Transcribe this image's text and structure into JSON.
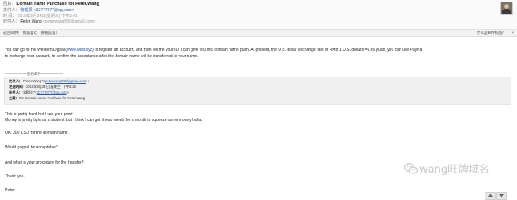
{
  "header": {
    "subject_key": "回复：",
    "subject": "Domain name Purchase for Peter.Wang",
    "from_key": "发件人：",
    "from_name": "管理员",
    "from_email": "<32777077@qq.com>",
    "time_key": "时  间：",
    "time": "2016年8月24日(星期三) 下午3:41",
    "to_key": "收件人：",
    "to_name": "Peter Wang",
    "to_email": "<peterwang998@gmail.com>"
  },
  "toolbar": {
    "item1": "返回/邮件",
    "item2": "我最喜欢（要看设置）",
    "right": "什么是邮件标签？",
    "close": "×"
  },
  "body": {
    "p1_before": "You can go to the Western Digital (",
    "p1_link": "www.west.xyz",
    "p1_after": ") to register an account, and then tell me your ID, I can give you this domain name push. At present, the U.S. dollar exchange rate of RMB 1 U.S. dollars =6.65 yuan, you can use PayPal",
    "p1_line2": "to recharge your account, to confirm the acceptance after the domain name will be transferred to your name.",
    "separator": "——————原始邮件——————"
  },
  "quote": {
    "from_key": "发件人：",
    "from_value": "\"Peter Wang\";<",
    "from_email": "peterwang998@gmail.com",
    "from_tail": ">;",
    "time_key": "发送时间：",
    "time_value": "2016年8月24日(星期三) 下午3:26",
    "to_key": "收件人：",
    "to_value": "\"域面尔\"<",
    "to_email": "32777077@qq.com",
    "to_tail": ">;",
    "subject_key": "主题：",
    "subject_value": "Re: Domain name Purchase for Peter.Wang"
  },
  "reply": {
    "l1": "This is pretty hard but I see your point.",
    "l2": "Money is pretty tight as a student, but I think I can get cheap meals for a month to squeeze some money haha.",
    "l3": "OK. 300 USD for the domain name.",
    "l4": "Would paypal be acceptable?",
    "l5": "And what is your procedure for the transfer?",
    "l6": "Thank you,",
    "l7": "Peter"
  },
  "watermark": {
    "text": "wang旺牌域名"
  },
  "icons": {
    "avatar": "avatar-photo",
    "watermark_logo": "wechat-logo-icon",
    "scroll_up": "arrow-up-icon",
    "scroll_down": "arrow-down-icon"
  }
}
